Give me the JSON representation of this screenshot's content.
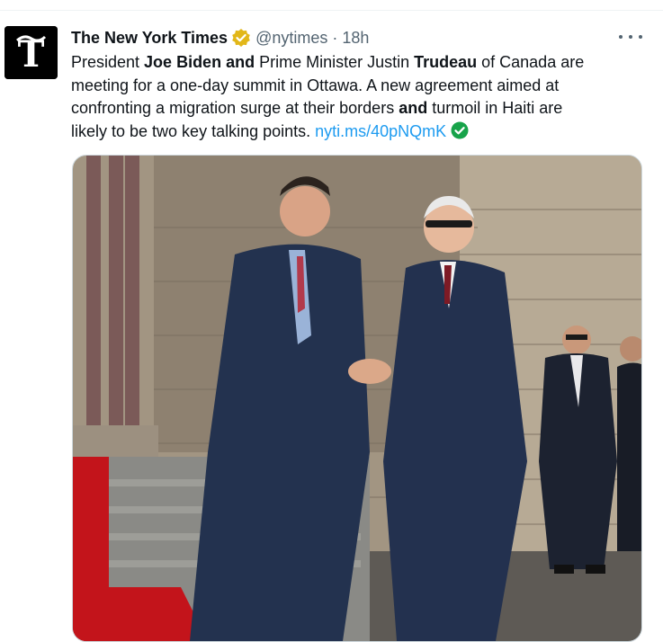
{
  "tweet": {
    "author_name": "The New York Times",
    "handle": "@nytimes",
    "separator": "·",
    "time": "18h",
    "text_lines": [
      [
        "President ",
        "Joe Biden and",
        " Prime Minister Justin ",
        "Trudeau",
        " of Canada are"
      ],
      [
        "meeting for a one-day summit in Ottawa. A new agreement aimed at"
      ],
      [
        "confronting a migration surge at their borders ",
        "and",
        " turmoil in Haiti are"
      ],
      [
        "likely to be two key talking points. "
      ]
    ],
    "link_text": "nyti.ms/40pNQmK"
  },
  "icons": {
    "avatar": "nyt-logo-icon",
    "verified": "verified-gold-badge-icon",
    "more": "more-options-icon",
    "link_check": "green-check-icon"
  },
  "colors": {
    "link": "#1d9bf0",
    "verified_gold": "#e2b719",
    "check_green": "#17a34a",
    "secondary_text": "#536471"
  }
}
